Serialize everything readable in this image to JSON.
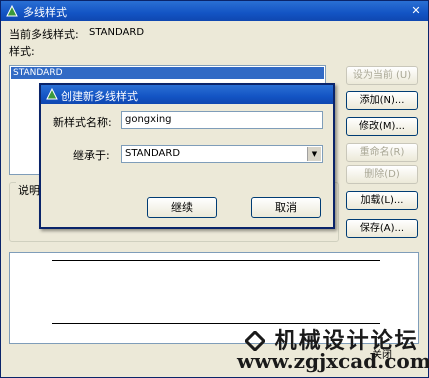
{
  "window": {
    "title": "多线样式",
    "close_glyph": "✕"
  },
  "main": {
    "current_label": "当前多线样式:",
    "current_value": "STANDARD",
    "styles_label": "样式:",
    "styles": [
      "STANDARD"
    ],
    "description_label": "说明",
    "buttons": {
      "set_current": "设为当前 (U)",
      "new": "添加(N)...",
      "modify": "修改(M)...",
      "rename": "重命名(R)",
      "delete": "删除(D)",
      "load": "加载(L)...",
      "save": "保存(A)...",
      "close": "关闭"
    }
  },
  "dialog": {
    "title": "创建新多线样式",
    "new_name_label": "新样式名称:",
    "new_name_value": "gongxing",
    "based_on_label": "继承于:",
    "based_on_value": "STANDARD",
    "continue": "继续",
    "cancel": "取消"
  },
  "watermark": {
    "line1": "机械设计论坛",
    "line2": "www.zgjxcad.com"
  },
  "colors": {
    "titlebar": "#1354c4",
    "selection": "#316ac5",
    "face": "#ece9d8"
  }
}
